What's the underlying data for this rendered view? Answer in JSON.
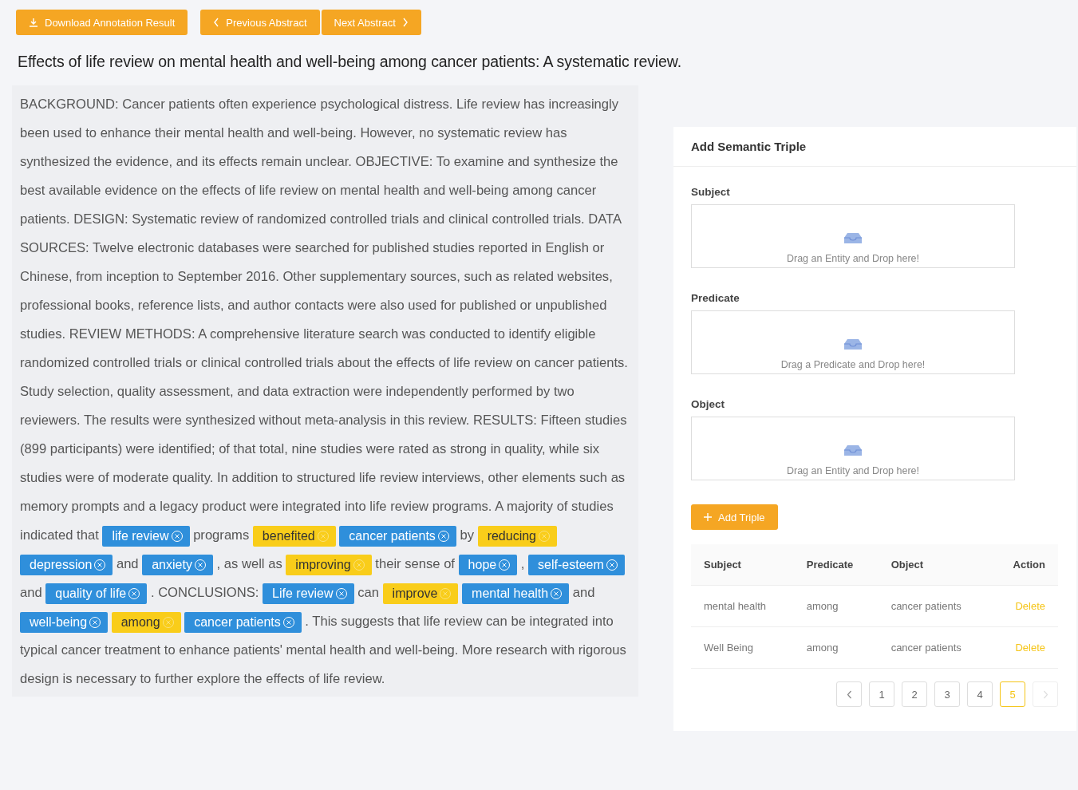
{
  "toolbar": {
    "download_button": "Download Annotation Result",
    "previous_button": "Previous Abstract",
    "next_button": "Next Abstract"
  },
  "title": "Effects of life review on mental health and well-being among cancer patients: A systematic review.",
  "abstract": [
    {
      "kind": "text",
      "text": "BACKGROUND: Cancer patients often experience psychological distress. Life review has increasingly been used to enhance their mental health and well-being. However, no systematic review has synthesized the evidence, and its effects remain unclear. OBJECTIVE: To examine and synthesize the best available evidence on the effects of life review on mental health and well-being among cancer patients. DESIGN: Systematic review of randomized controlled trials and clinical controlled trials. DATA SOURCES: Twelve electronic databases were searched for published studies reported in English or Chinese, from inception to September 2016. Other supplementary sources, such as related websites, professional books, reference lists, and author contacts were also used for published or unpublished studies. REVIEW METHODS: A comprehensive literature search was conducted to identify eligible randomized controlled trials or clinical controlled trials about the effects of life review on cancer patients. Study selection, quality assessment, and data extraction were independently performed by two reviewers. The results were synthesized without meta-analysis in this review. RESULTS: Fifteen studies (899 participants) were identified; of that total, nine studies were rated as strong in quality, while six studies were of moderate quality. In addition to structured life review interviews, other elements such as memory prompts and a legacy product were integrated into life review programs. A majority of studies indicated that"
    },
    {
      "kind": "entity",
      "text": "life review"
    },
    {
      "kind": "text",
      "text": "programs"
    },
    {
      "kind": "predicate",
      "text": "benefited"
    },
    {
      "kind": "entity",
      "text": "cancer patients"
    },
    {
      "kind": "text",
      "text": "by"
    },
    {
      "kind": "predicate",
      "text": "reducing"
    },
    {
      "kind": "entity",
      "text": "depression"
    },
    {
      "kind": "text",
      "text": "and"
    },
    {
      "kind": "entity",
      "text": "anxiety"
    },
    {
      "kind": "text",
      "text": ", as well as"
    },
    {
      "kind": "predicate",
      "text": "improving"
    },
    {
      "kind": "text",
      "text": "their sense of"
    },
    {
      "kind": "entity",
      "text": "hope"
    },
    {
      "kind": "text",
      "text": ","
    },
    {
      "kind": "entity",
      "text": "self-esteem"
    },
    {
      "kind": "text",
      "text": "and"
    },
    {
      "kind": "entity",
      "text": "quality of life"
    },
    {
      "kind": "text",
      "text": ". CONCLUSIONS:"
    },
    {
      "kind": "entity",
      "text": "Life review"
    },
    {
      "kind": "text",
      "text": "can"
    },
    {
      "kind": "predicate",
      "text": "improve"
    },
    {
      "kind": "entity",
      "text": "mental health"
    },
    {
      "kind": "text",
      "text": "and"
    },
    {
      "kind": "entity",
      "text": "well-being"
    },
    {
      "kind": "predicate",
      "text": "among"
    },
    {
      "kind": "entity",
      "text": "cancer patients"
    },
    {
      "kind": "text",
      "text": ". This suggests that life review can be integrated into typical cancer treatment to enhance patients' mental health and well-being. More research with rigorous design is necessary to further explore the effects of life review."
    }
  ],
  "triple_form": {
    "title": "Add Semantic Triple",
    "slots": [
      {
        "label": "Subject",
        "hint": "Drag an Entity and Drop here!"
      },
      {
        "label": "Predicate",
        "hint": "Drag a Predicate and Drop here!"
      },
      {
        "label": "Object",
        "hint": "Drag an Entity and Drop here!"
      }
    ],
    "add_button": "Add Triple"
  },
  "table": {
    "columns": [
      "Subject",
      "Predicate",
      "Object",
      "Action"
    ],
    "rows": [
      {
        "subject": "mental health",
        "predicate": "among",
        "object": "cancer patients",
        "action": "Delete"
      },
      {
        "subject": "Well Being",
        "predicate": "among",
        "object": "cancer patients",
        "action": "Delete"
      }
    ]
  },
  "pagination": {
    "pages": [
      {
        "label": "1",
        "selected": false
      },
      {
        "label": "2",
        "selected": false
      },
      {
        "label": "3",
        "selected": false
      },
      {
        "label": "4",
        "selected": false
      },
      {
        "label": "5",
        "selected": true
      }
    ],
    "next_disabled": true
  }
}
